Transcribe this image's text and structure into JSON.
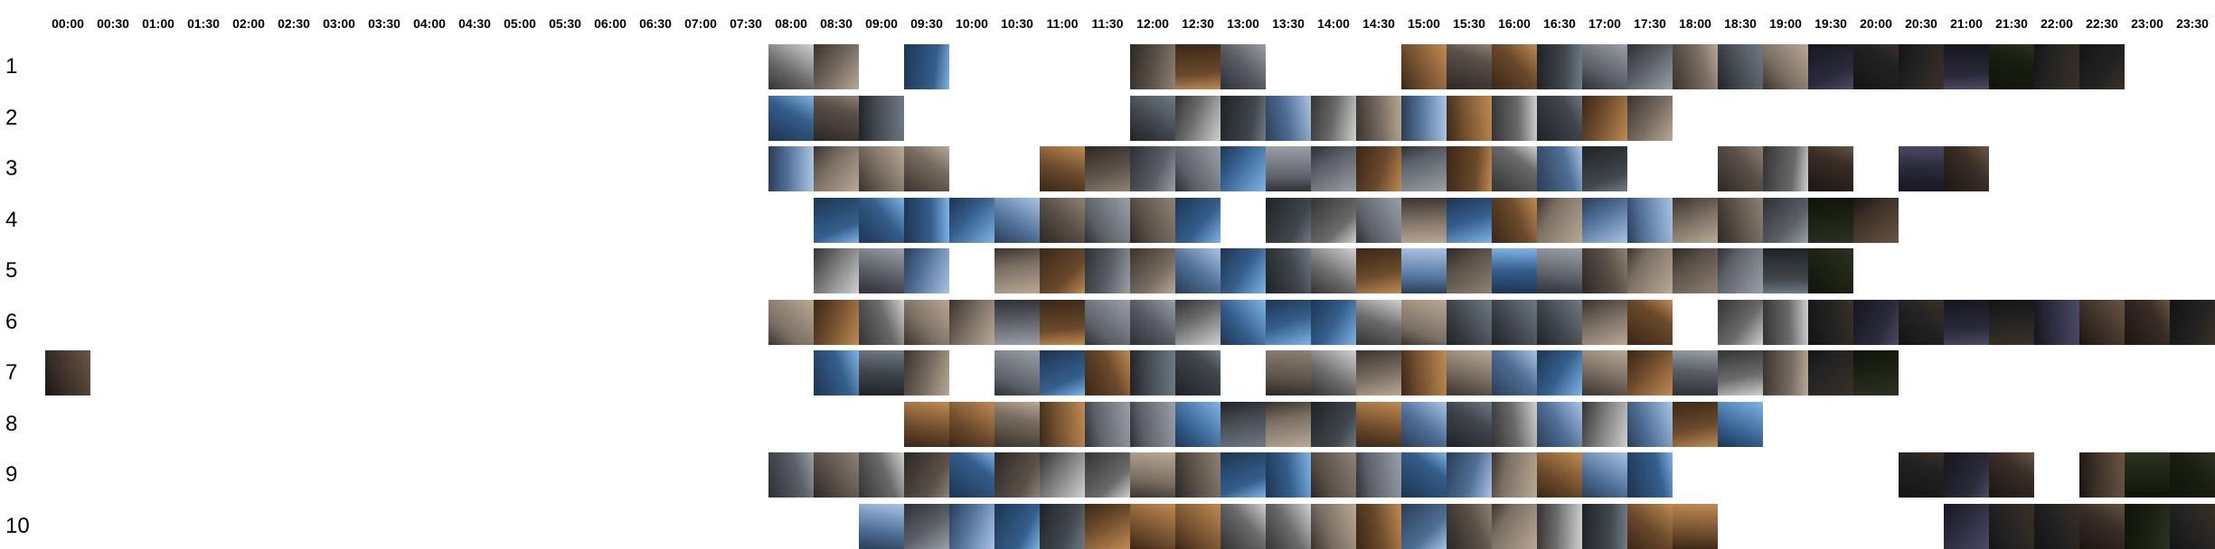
{
  "time_slots": [
    "00:00",
    "00:30",
    "01:00",
    "01:30",
    "02:00",
    "02:30",
    "03:00",
    "03:30",
    "04:00",
    "04:30",
    "05:00",
    "05:30",
    "06:00",
    "06:30",
    "07:00",
    "07:30",
    "08:00",
    "08:30",
    "09:00",
    "09:30",
    "10:00",
    "10:30",
    "11:00",
    "11:30",
    "12:00",
    "12:30",
    "13:00",
    "13:30",
    "14:00",
    "14:30",
    "15:00",
    "15:30",
    "16:00",
    "16:30",
    "17:00",
    "17:30",
    "18:00",
    "18:30",
    "19:00",
    "19:30",
    "20:00",
    "20:30",
    "21:00",
    "21:30",
    "22:00",
    "22:30",
    "23:00",
    "23:30"
  ],
  "rows": [
    {
      "label": "1",
      "slots": [
        16,
        17,
        19,
        24,
        25,
        26,
        30,
        31,
        32,
        33,
        34,
        35,
        36,
        37,
        38,
        39,
        40,
        41,
        42,
        43,
        44,
        45
      ]
    },
    {
      "label": "2",
      "slots": [
        16,
        17,
        18,
        24,
        25,
        26,
        27,
        28,
        29,
        30,
        31,
        32,
        33,
        34,
        35
      ]
    },
    {
      "label": "3",
      "slots": [
        16,
        17,
        18,
        19,
        22,
        23,
        24,
        25,
        26,
        27,
        28,
        29,
        30,
        31,
        32,
        33,
        34,
        37,
        38,
        39,
        41,
        42
      ]
    },
    {
      "label": "4",
      "slots": [
        17,
        18,
        19,
        20,
        21,
        22,
        23,
        24,
        25,
        27,
        28,
        29,
        30,
        31,
        32,
        33,
        34,
        35,
        36,
        37,
        38,
        39,
        40
      ]
    },
    {
      "label": "5",
      "slots": [
        17,
        18,
        19,
        21,
        22,
        23,
        24,
        25,
        26,
        27,
        28,
        29,
        30,
        31,
        32,
        33,
        34,
        35,
        36,
        37,
        38,
        39
      ]
    },
    {
      "label": "6",
      "slots": [
        16,
        17,
        18,
        19,
        20,
        21,
        22,
        23,
        24,
        25,
        26,
        27,
        28,
        29,
        30,
        31,
        32,
        33,
        34,
        35,
        37,
        38,
        39,
        40,
        41,
        42,
        43,
        44,
        45,
        46,
        47
      ]
    },
    {
      "label": "7",
      "slots": [
        0,
        17,
        18,
        19,
        21,
        22,
        23,
        24,
        25,
        27,
        28,
        29,
        30,
        31,
        32,
        33,
        34,
        35,
        36,
        37,
        38,
        39,
        40
      ]
    },
    {
      "label": "8",
      "slots": [
        19,
        20,
        21,
        22,
        23,
        24,
        25,
        26,
        27,
        28,
        29,
        30,
        31,
        32,
        33,
        34,
        35,
        36,
        37
      ]
    },
    {
      "label": "9",
      "slots": [
        16,
        17,
        18,
        19,
        20,
        21,
        22,
        23,
        24,
        25,
        26,
        27,
        28,
        29,
        30,
        31,
        32,
        33,
        34,
        35,
        41,
        42,
        43,
        45,
        46,
        47
      ]
    },
    {
      "label": "10",
      "slots": [
        18,
        19,
        20,
        21,
        22,
        23,
        24,
        25,
        26,
        27,
        28,
        29,
        30,
        31,
        32,
        33,
        34,
        35,
        36,
        42,
        43,
        44,
        45,
        46,
        47
      ]
    }
  ]
}
